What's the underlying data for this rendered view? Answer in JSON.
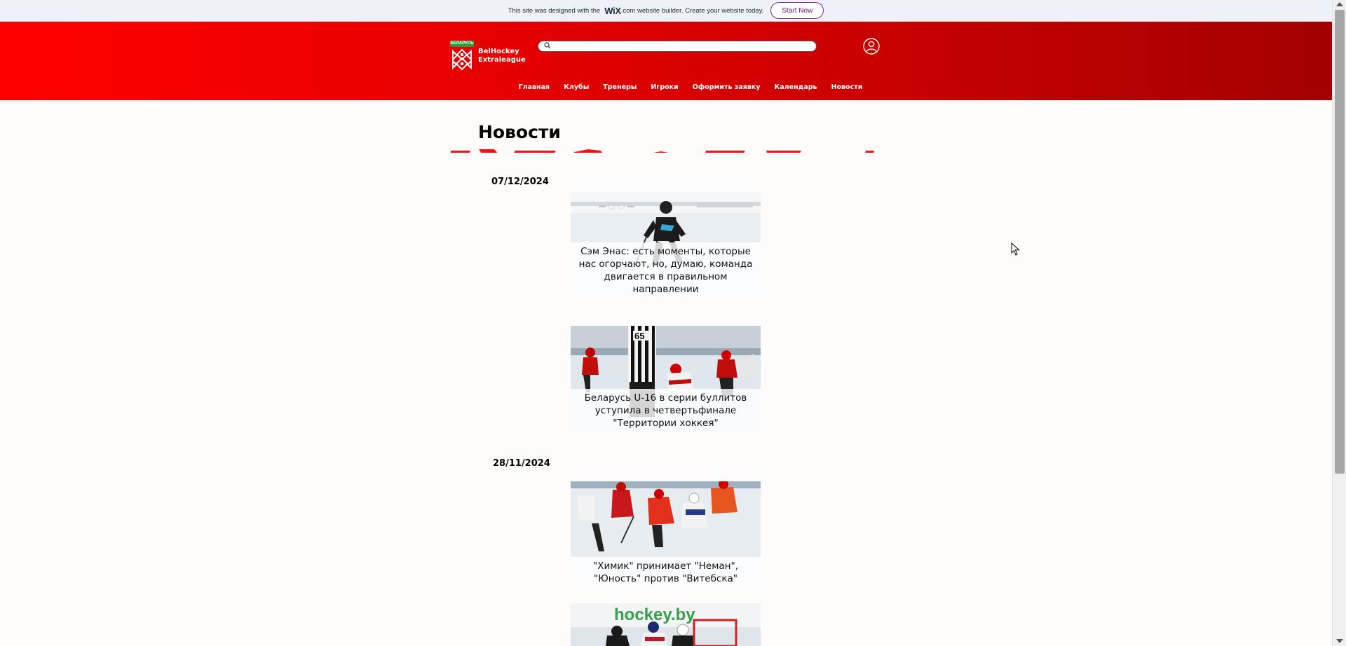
{
  "wix_banner": {
    "text_before": "This site was designed with the",
    "brand": "WiX",
    "text_after": ".com website builder. Create your website today.",
    "cta_label": "Start Now"
  },
  "header": {
    "logo_badge": "БЕЛАРУСЬ",
    "logo_line1": "BelHockey",
    "logo_line2": "Extraleague",
    "search_placeholder": "",
    "nav": [
      {
        "label": "Главная"
      },
      {
        "label": "Клубы"
      },
      {
        "label": "Тренеры"
      },
      {
        "label": "Игроки"
      },
      {
        "label": "Оформить заявку"
      },
      {
        "label": "Календарь"
      },
      {
        "label": "Новости"
      }
    ]
  },
  "main": {
    "title": "Новости",
    "groups": [
      {
        "date": "07/12/2024",
        "items": [
          {
            "title": "Сэм Энас: есть моменты, которые нас огорчают, но, думаю, команда двигается в правильном направлении"
          },
          {
            "title": "Беларусь U-16 в серии буллитов уступила в четвертьфинале \"Территории хоккея\""
          }
        ]
      },
      {
        "date": "28/11/2024",
        "items": [
          {
            "title": "\"Химик\" принимает \"Неман\", \"Юность\" против \"Витебска\""
          },
          {
            "title": ""
          }
        ]
      }
    ],
    "photo_texts": {
      "referee_number": "65",
      "board_text": "hockey.by"
    }
  },
  "colors": {
    "header_gradient_start": "#ff0000",
    "header_gradient_end": "#a30000",
    "logo_green": "#2f9a35",
    "wix_cta": "#6b1c6b"
  }
}
